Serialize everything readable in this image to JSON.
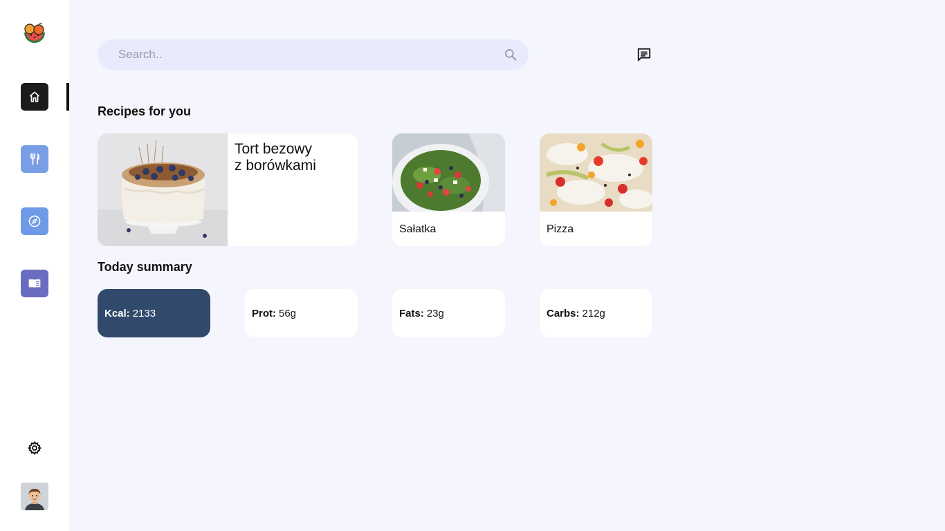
{
  "sidebar": {
    "logo": "watermelon-fruit-logo",
    "items": [
      {
        "name": "home",
        "icon": "home-icon",
        "active": true,
        "color": "#1b1b1b"
      },
      {
        "name": "recipes",
        "icon": "fork-knife-icon",
        "active": false,
        "color": "#7a9ee6"
      },
      {
        "name": "explore",
        "icon": "compass-icon",
        "active": false,
        "color": "#6e9ae8"
      },
      {
        "name": "book",
        "icon": "open-book-icon",
        "active": false,
        "color": "#6a6cc2"
      }
    ],
    "settings_icon": "gear-icon",
    "avatar": "user-avatar"
  },
  "header": {
    "search_placeholder": "Search..",
    "search_icon": "search-icon",
    "messages_icon": "message-icon"
  },
  "recipes": {
    "title": "Recipes for you",
    "featured": {
      "name": "Tort bezowy\nz borówkami"
    },
    "items": [
      {
        "name": "Sałatka"
      },
      {
        "name": "Pizza"
      }
    ]
  },
  "summary": {
    "title": "Today summary",
    "kcal": {
      "label": "Kcal:",
      "value": "2133"
    },
    "prot": {
      "label": "Prot:",
      "value": "56g"
    },
    "fats": {
      "label": "Fats:",
      "value": "23g"
    },
    "carbs": {
      "label": "Carbs:",
      "value": "212g"
    }
  },
  "colors": {
    "background": "#f4f5fd",
    "sidebar": "#ffffff",
    "kcal_card": "#314a6c",
    "search_bg": "#e9eafb"
  }
}
